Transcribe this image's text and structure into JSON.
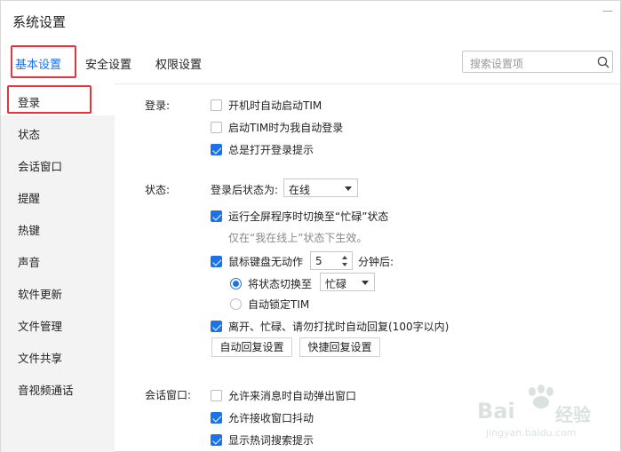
{
  "window": {
    "title": "系统设置",
    "close_glyph": "—"
  },
  "tabs": [
    {
      "label": "基本设置",
      "active": true
    },
    {
      "label": "安全设置",
      "active": false
    },
    {
      "label": "权限设置",
      "active": false
    }
  ],
  "search": {
    "placeholder": "搜索设置项"
  },
  "sidebar": {
    "items": [
      {
        "label": "登录",
        "active": true
      },
      {
        "label": "状态"
      },
      {
        "label": "会话窗口"
      },
      {
        "label": "提醒"
      },
      {
        "label": "热键"
      },
      {
        "label": "声音"
      },
      {
        "label": "软件更新"
      },
      {
        "label": "文件管理"
      },
      {
        "label": "文件共享"
      },
      {
        "label": "音视频通话"
      }
    ]
  },
  "login": {
    "label": "登录:",
    "options": [
      {
        "label": "开机时自动启动TIM",
        "checked": false
      },
      {
        "label": "启动TIM时为我自动登录",
        "checked": false
      },
      {
        "label": "总是打开登录提示",
        "checked": true
      }
    ]
  },
  "status": {
    "label": "状态:",
    "after_login_label": "登录后状态为:",
    "after_login_value": "在线",
    "fullscreen_busy": {
      "label": "运行全屏程序时切换至“忙碌”状态",
      "checked": true
    },
    "fullscreen_hint": "仅在“我在线上”状态下生效。",
    "idle": {
      "label": "鼠标键盘无动作",
      "checked": true,
      "minutes": "5",
      "suffix": "分钟后:"
    },
    "idle_switch": {
      "label": "将状态切换至",
      "selected": true,
      "value": "忙碌"
    },
    "idle_lock": {
      "label": "自动锁定TIM",
      "selected": false
    },
    "auto_reply": {
      "label": "离开、忙碌、请勿打扰时自动回复(100字以内)",
      "checked": true
    },
    "btn_auto_reply": "自动回复设置",
    "btn_quick_reply": "快捷回复设置"
  },
  "session": {
    "label": "会话窗口:",
    "options": [
      {
        "label": "允许来消息时自动弹出窗口",
        "checked": false
      },
      {
        "label": "允许接收窗口抖动",
        "checked": true
      },
      {
        "label": "显示热词搜索提示",
        "checked": true
      }
    ]
  },
  "watermark": {
    "line1": "Bai",
    "line2": "经验",
    "line3": "jingyan.baidu.com"
  },
  "colors": {
    "accent": "#1a73e8",
    "highlight_box": "#e8323c",
    "sidebar_bg": "#f3f3f3"
  }
}
